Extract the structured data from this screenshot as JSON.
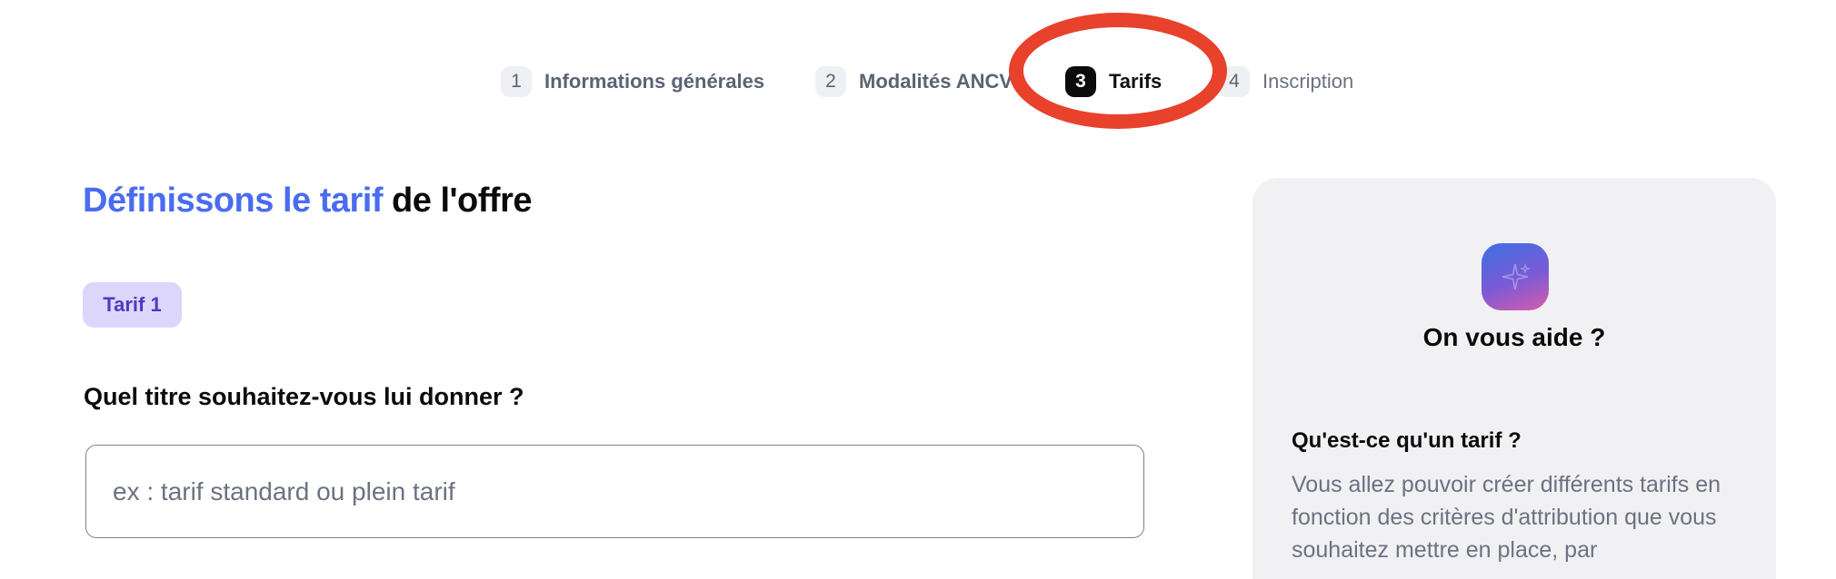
{
  "stepper": {
    "steps": [
      {
        "number": "1",
        "label": "Informations générales",
        "state": "done"
      },
      {
        "number": "2",
        "label": "Modalités ANCV",
        "state": "done"
      },
      {
        "number": "3",
        "label": "Tarifs",
        "state": "active"
      },
      {
        "number": "4",
        "label": "Inscription",
        "state": "todo"
      }
    ]
  },
  "main": {
    "title_accent": "Définissons le tarif",
    "title_rest": "de l'offre",
    "tarif_chip": "Tarif 1",
    "field_label": "Quel titre souhaitez-vous lui donner ?",
    "title_input": {
      "value": "",
      "placeholder": "ex : tarif standard ou plein tarif"
    }
  },
  "help": {
    "title": "On vous aide ?",
    "question": "Qu'est-ce qu'un tarif ?",
    "text": "Vous allez pouvoir créer différents tarifs en fonction des critères d'attribution que vous souhaitez mettre en place, par"
  },
  "colors": {
    "accent": "#4a6cf0",
    "chip_bg": "#ddd6fb",
    "chip_text": "#4b3cc2",
    "annotation": "#e8412c",
    "panel_bg": "#f1f1f3"
  },
  "icons": {
    "help_logo": "sparkles-icon"
  }
}
